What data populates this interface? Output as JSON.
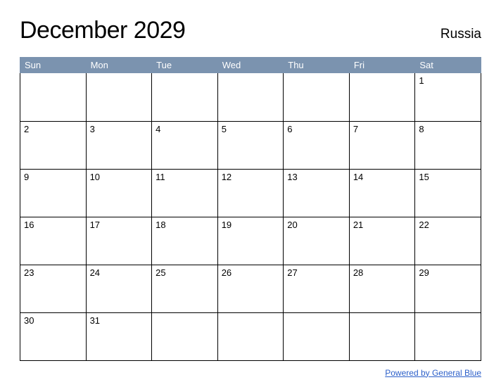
{
  "title": "December 2029",
  "region": "Russia",
  "weekdays": [
    "Sun",
    "Mon",
    "Tue",
    "Wed",
    "Thu",
    "Fri",
    "Sat"
  ],
  "weeks": [
    [
      "",
      "",
      "",
      "",
      "",
      "",
      "1"
    ],
    [
      "2",
      "3",
      "4",
      "5",
      "6",
      "7",
      "8"
    ],
    [
      "9",
      "10",
      "11",
      "12",
      "13",
      "14",
      "15"
    ],
    [
      "16",
      "17",
      "18",
      "19",
      "20",
      "21",
      "22"
    ],
    [
      "23",
      "24",
      "25",
      "26",
      "27",
      "28",
      "29"
    ],
    [
      "30",
      "31",
      "",
      "",
      "",
      "",
      ""
    ]
  ],
  "footer_link": "Powered by General Blue"
}
